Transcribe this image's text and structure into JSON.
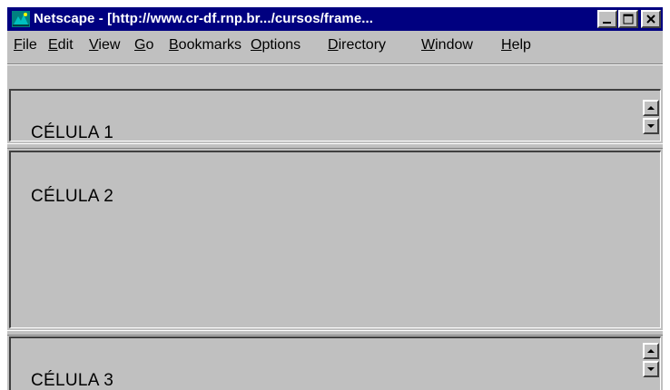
{
  "window": {
    "title": "Netscape - [http://www.cr-df.rnp.br.../cursos/frame...",
    "icons": {
      "app": "netscape-icon",
      "minimize": "minimize-icon",
      "maximize": "maximize-icon",
      "close": "close-icon"
    }
  },
  "menu": [
    {
      "mnemonic": "F",
      "rest": "ile"
    },
    {
      "mnemonic": "E",
      "rest": "dit"
    },
    {
      "mnemonic": "V",
      "rest": "iew"
    },
    {
      "mnemonic": "G",
      "rest": "o"
    },
    {
      "mnemonic": "B",
      "rest": "ookmarks"
    },
    {
      "mnemonic": "O",
      "rest": "ptions"
    },
    {
      "mnemonic": "D",
      "rest": "irectory"
    },
    {
      "mnemonic": "W",
      "rest": "indow"
    },
    {
      "pre": "",
      "mnemonic": "H",
      "rest": "elp"
    }
  ],
  "frames": [
    {
      "label": "CÉLULA 1",
      "has_scrollbar": true
    },
    {
      "label": "CÉLULA 2",
      "has_scrollbar": false
    },
    {
      "label": "CÉLULA 3",
      "has_scrollbar": true
    }
  ],
  "colors": {
    "titlebar": "#000080",
    "face": "#c0c0c0",
    "shadow": "#808080",
    "dark": "#404040",
    "highlight": "#ffffff"
  }
}
